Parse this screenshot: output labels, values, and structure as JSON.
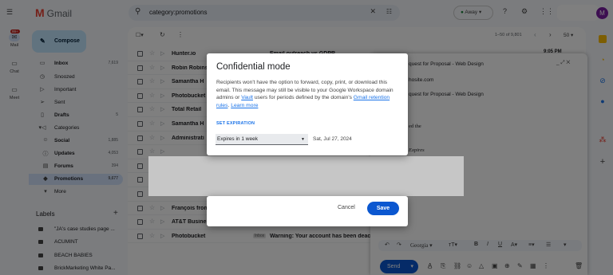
{
  "app": {
    "name": "Gmail",
    "unread_badge": "99+"
  },
  "rail": [
    {
      "label": "Mail",
      "icon": "mail-icon"
    },
    {
      "label": "Chat",
      "icon": "chat-icon"
    },
    {
      "label": "Meet",
      "icon": "meet-icon"
    }
  ],
  "search": {
    "value": "category:promotions"
  },
  "header": {
    "status": "Away",
    "avatar": "M"
  },
  "sidebar": {
    "compose": "Compose",
    "items": [
      {
        "label": "Inbox",
        "count": "7,619",
        "icon": "inbox-icon"
      },
      {
        "label": "Snoozed",
        "count": "",
        "icon": "clock-icon"
      },
      {
        "label": "Important",
        "count": "",
        "icon": "important-icon"
      },
      {
        "label": "Sent",
        "count": "",
        "icon": "send-icon"
      },
      {
        "label": "Drafts",
        "count": "5",
        "icon": "draft-icon"
      },
      {
        "label": "Categories",
        "count": "",
        "icon": "label-icon"
      },
      {
        "label": "Social",
        "count": "1,885",
        "icon": "people-icon"
      },
      {
        "label": "Updates",
        "count": "4,053",
        "icon": "info-icon"
      },
      {
        "label": "Forums",
        "count": "394",
        "icon": "forum-icon"
      },
      {
        "label": "Promotions",
        "count": "9,677",
        "icon": "tag-icon"
      },
      {
        "label": "More",
        "count": "",
        "icon": "chevron-down-icon"
      }
    ],
    "labels_heading": "Labels",
    "labels": [
      "\"JA's case studies page ...",
      "ACUMINT",
      "BEACH BABIES",
      "BrickMarketing White Pa..."
    ]
  },
  "toolbar": {
    "pagination": "1–50 of 9,801",
    "zoom": "50"
  },
  "emails": [
    {
      "sender": "Hunter.io",
      "tag": "",
      "subject": "Email outreach vs GDPR"
    },
    {
      "sender": "Robin Robins",
      "tag": "",
      "subject": ""
    },
    {
      "sender": "Samantha H",
      "tag": "",
      "subject": ""
    },
    {
      "sender": "Photobucket",
      "tag": "",
      "subject": ""
    },
    {
      "sender": "Total Retail",
      "tag": "",
      "subject": ""
    },
    {
      "sender": "Samantha H",
      "tag": "",
      "subject": ""
    },
    {
      "sender": "Administrati",
      "tag": "",
      "subject": ""
    },
    {
      "sender": "",
      "tag": "",
      "subject": ""
    },
    {
      "sender": "",
      "tag": "",
      "subject": ""
    },
    {
      "sender": "Felix from H",
      "tag": "",
      "subject": ""
    },
    {
      "sender": "Photobucket",
      "tag": "",
      "subject": ""
    },
    {
      "sender": "François from Hunter",
      "tag": "Inbox",
      "subject": "We have another Chrome extension -"
    },
    {
      "sender": "AT&T Business",
      "tag": "Inbox",
      "subject": "Learn how to get the Samsung Galaxy"
    },
    {
      "sender": "Photobucket",
      "tag": "Inbox",
      "subject": "Warning: Your account has been deac"
    }
  ],
  "compose_window": {
    "time": "9:05 PM",
    "subject_lines": [
      "quest for Proposal - Web Design",
      "hosite.com",
      "quest for Proposal - Web Design",
      "ed the",
      "Expires"
    ],
    "font": "Georgia",
    "send": "Send"
  },
  "dialog": {
    "title": "Confidential mode",
    "body_before": "Recipients won't have the option to forward, copy, print, or download this email. This message may still be visible to your Google Workspace domain admins or ",
    "link_vault": "Vault",
    "body_middle": " users for periods defined by the domain's ",
    "link_retention": "Gmail retention rules",
    "body_after": ". ",
    "link_learn": "Learn more",
    "set_expiration": "SET EXPIRATION",
    "expires_option": "Expires in 1 week",
    "expire_date": "Sat, Jul 27, 2024",
    "cancel": "Cancel",
    "save": "Save"
  },
  "colors": {
    "accent": "#0b57d0",
    "link": "#1a73e8",
    "active_nav": "#d3e3fd",
    "compose": "#c2e7ff"
  }
}
